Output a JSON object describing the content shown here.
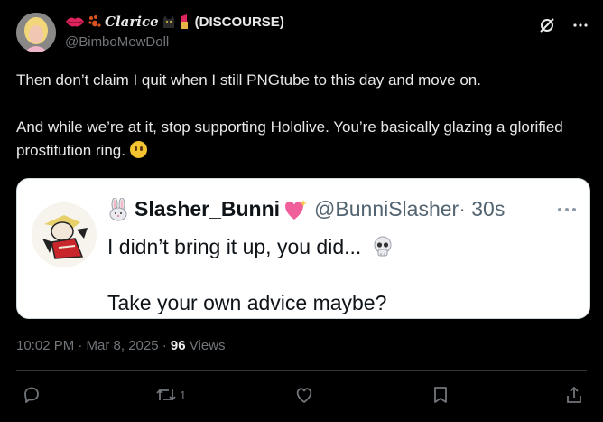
{
  "author": {
    "display_name": "Clarice",
    "display_suffix": "(DISCOURSE)",
    "handle": "@BimboMewDoll"
  },
  "post": {
    "paragraph_1": "Then don’t claim I quit when I still PNGtube to this day and move on.",
    "paragraph_2": "And while we’re at it, stop supporting Hololive.  You’re basically glazing a glorified prostitution ring.",
    "emoji": "neutral-face-emoji"
  },
  "quoted": {
    "name": "Slasher_Bunni",
    "handle": "@BunniSlasher",
    "time": "· 30s",
    "line_1": "I didn’t bring it up, you did...",
    "line_2": "Take your own advice maybe?"
  },
  "meta": {
    "timestamp": "10:02 PM · Mar 8, 2025 · ",
    "views_count": "96",
    "views_label": " Views"
  },
  "actions": {
    "retweet_count": "1"
  },
  "colors": {
    "background": "#000000",
    "text": "#e7e9ea",
    "muted": "#71767b",
    "card_bg": "#ffffff"
  }
}
